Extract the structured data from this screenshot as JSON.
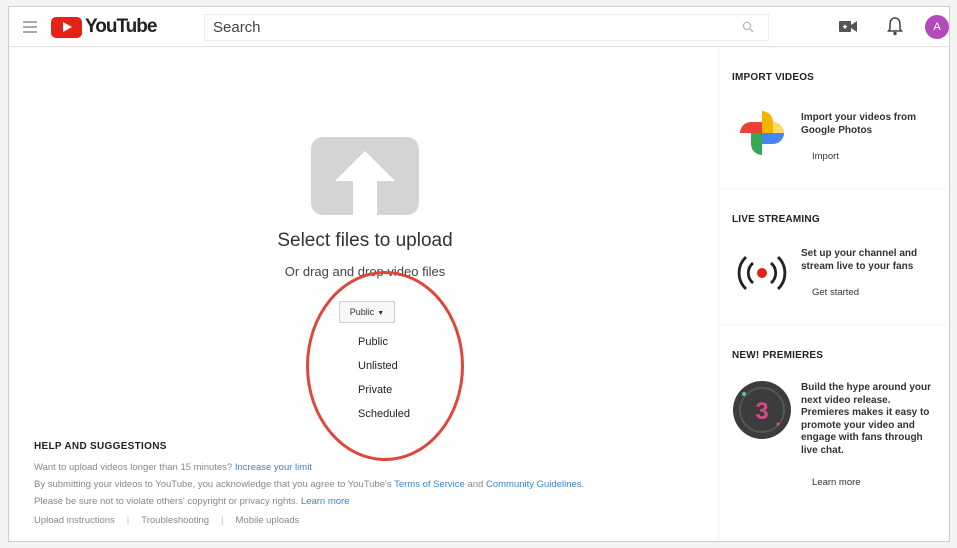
{
  "header": {
    "logo_text": "YouTube",
    "search_placeholder": "Search",
    "avatar_initial": "A"
  },
  "upload": {
    "title": "Select files to upload",
    "subtitle": "Or drag and drop video files",
    "privacy_selected": "Public",
    "privacy_options": [
      "Public",
      "Unlisted",
      "Private",
      "Scheduled"
    ]
  },
  "help": {
    "title": "HELP AND SUGGESTIONS",
    "line1_text": "Want to upload videos longer than 15 minutes? ",
    "line1_link": "Increase your limit",
    "line2_a": "By submitting your videos to YouTube, you acknowledge that you agree to YouTube's ",
    "line2_link1": "Terms of Service",
    "line2_b": " and ",
    "line2_link2": "Community Guidelines",
    "line2_c": ".",
    "line3_text": "Please be sure not to violate others' copyright or privacy rights. ",
    "line3_link": "Learn more",
    "links": [
      "Upload instructions",
      "Troubleshooting",
      "Mobile uploads"
    ]
  },
  "rail": {
    "import": {
      "title": "IMPORT VIDEOS",
      "text": "Import your videos from Google Photos",
      "button": "Import"
    },
    "live": {
      "title": "LIVE STREAMING",
      "text": "Set up your channel and stream live to your fans",
      "button": "Get started"
    },
    "premieres": {
      "title": "NEW! PREMIERES",
      "text": "Build the hype around your next video release. Premieres makes it easy to promote your video and engage with fans through live chat.",
      "button": "Learn more",
      "badge_number": "3"
    }
  },
  "colors": {
    "brand_red": "#e62117",
    "link_blue": "#3a86c8",
    "highlight_ring": "#e0473c",
    "avatar_bg": "#b24ab8"
  }
}
